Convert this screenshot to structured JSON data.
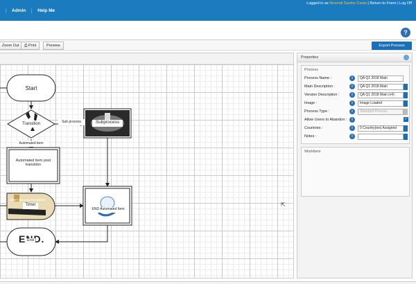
{
  "topbar": {
    "nav": [
      "",
      "Admin",
      "Help Me"
    ],
    "logged_prefix": "Logged in as",
    "user_name": "Nnemdi Santos Cadai",
    "return_link": "Return to Fnem",
    "logoff": "Log Off"
  },
  "toolbar": {
    "zoom_out": "Zoom Out",
    "print": "Print",
    "preview": "Preview",
    "export": "Export Process"
  },
  "diagram": {
    "start": "Start",
    "transition": "Transition",
    "subprocess": "Subprocess",
    "sub_process_edge": "Sub process",
    "automated_item_edge": "Automated item",
    "automated_post": "Automated item post transition",
    "timer": "Timer",
    "end_automated": "END Automated Item",
    "end": "End",
    "dont_be_bottleneck": "DON'T BE A BOTTLENECK",
    "end_image_text": "END."
  },
  "properties": {
    "header": "Properties",
    "section_title": "Process",
    "rows": [
      {
        "label": "Process Name :",
        "value": "QA Q1 2018 Main"
      },
      {
        "label": "Main Description :",
        "value": "QA Q1 2018 Main"
      },
      {
        "label": "Version Description :",
        "value": "QA Q1 2018 Main (v4)"
      },
      {
        "label": "Image :",
        "value": "Image Loaded"
      },
      {
        "label": "Process Type :",
        "value": "Standard Process"
      },
      {
        "label": "Allow Users to Abandon :",
        "value": ""
      },
      {
        "label": "Countries :",
        "value": "0 Country(ies) Assigned"
      },
      {
        "label": "Notes :",
        "value": ""
      }
    ],
    "workitem_title": "WorkItem"
  },
  "colors": {
    "topbar": "#1a7bbf",
    "accent_button": "#1a6fb5",
    "username": "#f6c244"
  }
}
